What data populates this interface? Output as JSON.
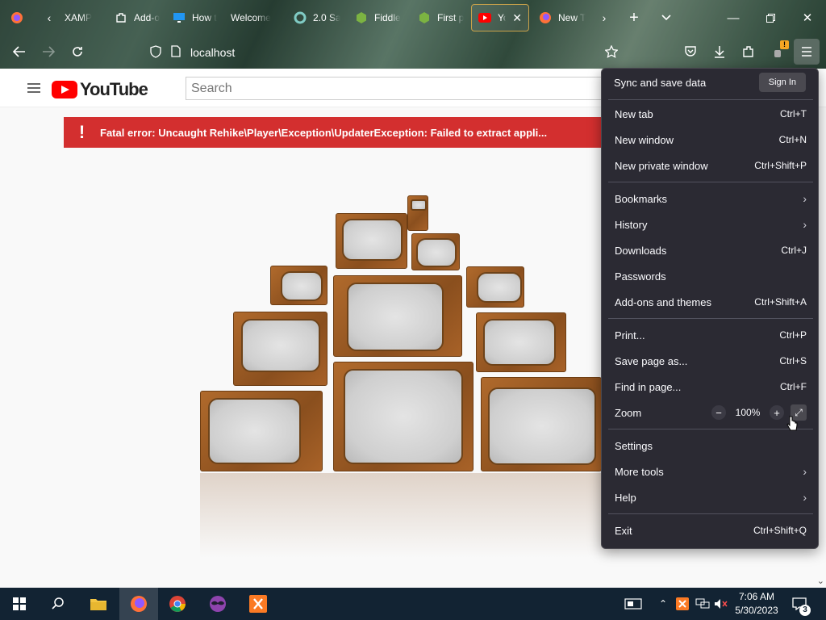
{
  "browser": {
    "tabs": [
      {
        "title": "XAMP",
        "favicon": "xampp-icon",
        "color": "#fb7a24"
      },
      {
        "title": "Add-o",
        "favicon": "puzzle-icon",
        "color": "#ffffff"
      },
      {
        "title": "How t",
        "favicon": "monitor-icon",
        "color": "#2196f3"
      },
      {
        "title": "Welcome",
        "favicon": "page-icon",
        "color": "#cccccc"
      },
      {
        "title": "2.0 Sa",
        "favicon": "circle-icon",
        "color": "#26a69a"
      },
      {
        "title": "Fiddle",
        "favicon": "nginx-icon",
        "color": "#7cb342"
      },
      {
        "title": "First p",
        "favicon": "nginx-icon",
        "color": "#7cb342"
      },
      {
        "title": "Yo",
        "favicon": "youtube-icon",
        "color": "#ff0000"
      },
      {
        "title": "New T",
        "favicon": "firefox-icon",
        "color": "#ff7139"
      }
    ],
    "url": "localhost",
    "notification_badge": "!"
  },
  "youtube": {
    "logo_text": "YouTube",
    "search_placeholder": "Search",
    "error_icon": "!",
    "error_message": "Fatal error: Uncaught Rehike\\Player\\Exception\\UpdaterException: Failed to extract appli..."
  },
  "app_menu": {
    "sync_label": "Sync and save data",
    "sign_in": "Sign In",
    "items": [
      {
        "label": "New tab",
        "shortcut": "Ctrl+T"
      },
      {
        "label": "New window",
        "shortcut": "Ctrl+N"
      },
      {
        "label": "New private window",
        "shortcut": "Ctrl+Shift+P"
      },
      {
        "label": "Bookmarks",
        "shortcut": ""
      },
      {
        "label": "History",
        "shortcut": ""
      },
      {
        "label": "Downloads",
        "shortcut": "Ctrl+J"
      },
      {
        "label": "Passwords",
        "shortcut": ""
      },
      {
        "label": "Add-ons and themes",
        "shortcut": "Ctrl+Shift+A"
      },
      {
        "label": "Print...",
        "shortcut": "Ctrl+P"
      },
      {
        "label": "Save page as...",
        "shortcut": "Ctrl+S"
      },
      {
        "label": "Find in page...",
        "shortcut": "Ctrl+F"
      },
      {
        "label": "Zoom",
        "shortcut": ""
      },
      {
        "label": "Settings",
        "shortcut": ""
      },
      {
        "label": "More tools",
        "shortcut": ""
      },
      {
        "label": "Help",
        "shortcut": ""
      },
      {
        "label": "Exit",
        "shortcut": "Ctrl+Shift+Q"
      }
    ],
    "zoom_level": "100%",
    "zoom_minus": "−",
    "zoom_plus": "+"
  },
  "taskbar": {
    "time": "7:06 AM",
    "date": "5/30/2023",
    "notification_count": "3"
  }
}
